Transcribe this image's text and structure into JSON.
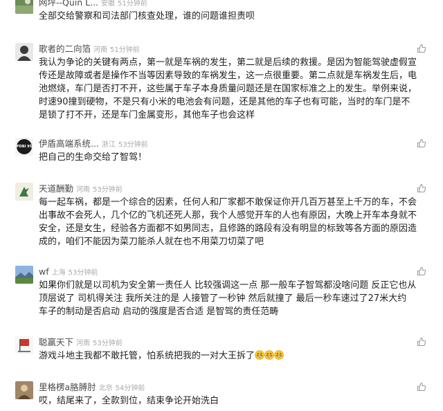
{
  "comments": [
    {
      "username": "网坪--Quin L...",
      "location": "安徽",
      "time": "51分钟前",
      "text": "全部交给警察和司法部门核查处理，谁的问题谁担责呗"
    },
    {
      "username": "歌者的二向箔",
      "location": "河南",
      "time": "51分钟前",
      "text": "我认为争论的关键有两点，第一就是车祸的发生，第二就是后续的救援。是因为智能驾驶虚假宣传还是故障或者是操作不当等因素导致的车祸发生，这一点很重要。第二点就是车祸发生后，电池燃烧，车门是否打不开，这些属于车子本身质量问题还是在国家标准之上的发生。举例来说，时速90撞到硬物，不是只有小米的电池会有问题，还是其他的车子也有可能，当时的车门是不是锁了打不开，还是车门金属变形，其他车子也会这样"
    },
    {
      "username": "伊盾高端系统...",
      "location": "浙江",
      "time": "53分钟前",
      "text": "把自己的生命交给了智驾！"
    },
    {
      "username": "天道酬勤",
      "location": "河南",
      "time": "53分钟前",
      "text": "每一起车祸，都是一个综合的因素，任何人和厂家都不敢保证你开几百万甚至上千万的车，不会出事故不会死人，几个亿的飞机还死人那，我个人感觉开车的人也有原因，大晚上开车本身就不安全，还是女生，经验各方面都不如男同志，且修路的路段有没有明显的标致等各方面的原因造成的，咱们不能因为菜刀能杀人就在也不用菜刀切菜了吧"
    },
    {
      "username": "wf",
      "location": "上海",
      "time": "53分钟前",
      "text": "如果你们就是以司机为安全第一责任人 比较强调这一点 那一般车子智驾都没啥问题 反正它也从顶层说了 司机得关注  我所关注的是 人接管了一秒钟 然后就撞了 最后一秒车速过了27米大约  车子的制动是否启动 启动的强度是否合适 是智驾的责任范畴"
    },
    {
      "username": "聪赢天下",
      "location": "河南",
      "time": "53分钟前",
      "text": "游戏斗地主我都不敢托管，怕系统把我的一对大王拆了"
    },
    {
      "username": "里格楞a胳膊肘",
      "location": "北京",
      "time": "54分钟前",
      "text": "哎，结尾来了，全款到位，结束争论开始洗白"
    }
  ],
  "avatar_colors": [
    "#6d8a5a",
    "#3a3a3a",
    "#1c1c1c",
    "#3f7a43",
    "#5a7fb0",
    "#c8372d",
    "#a08666"
  ],
  "like_icon": "thumbs-up-icon",
  "emoji_icon": "grinning-face-icon",
  "emoji_count": 3,
  "avatar_badge": "PDBI 95"
}
